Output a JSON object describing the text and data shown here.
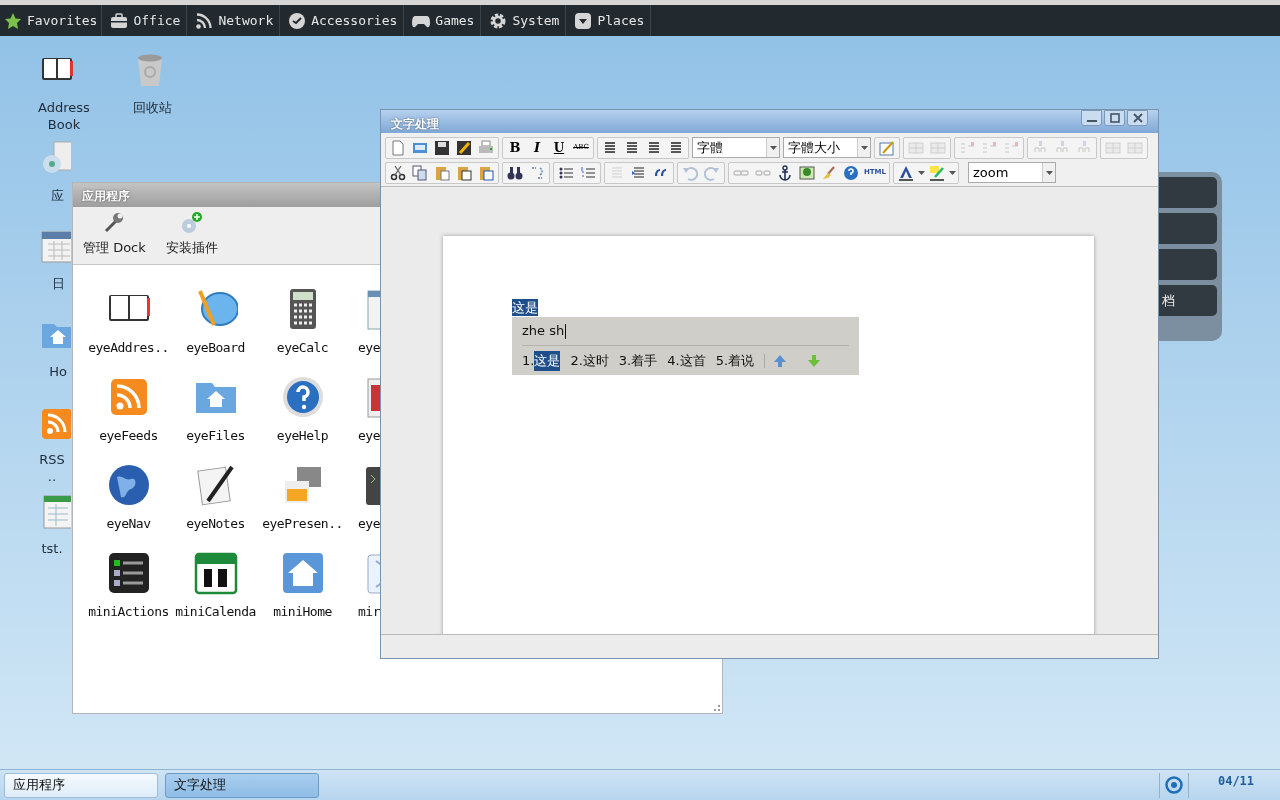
{
  "top_menu": [
    {
      "label": "Favorites"
    },
    {
      "label": "Office"
    },
    {
      "label": "Network"
    },
    {
      "label": "Accessories"
    },
    {
      "label": "Games"
    },
    {
      "label": "System"
    },
    {
      "label": "Places"
    }
  ],
  "desktop_icons": [
    {
      "label": "Address Book"
    },
    {
      "label": "回收站"
    },
    {
      "label": "应"
    },
    {
      "label": "日"
    },
    {
      "label": "Ho"
    },
    {
      "label": "RSS\n.."
    },
    {
      "label": "tst."
    }
  ],
  "dock": {
    "last_label": "档"
  },
  "apps_window": {
    "title": "应用程序",
    "toolbar": [
      {
        "label": "管理 Dock"
      },
      {
        "label": "安装插件"
      }
    ],
    "apps": [
      {
        "label": "eyeAddres.."
      },
      {
        "label": "eyeBoard"
      },
      {
        "label": "eyeCalc"
      },
      {
        "label": "eye"
      },
      {
        "label": "eyeFeeds"
      },
      {
        "label": "eyeFiles"
      },
      {
        "label": "eyeHelp"
      },
      {
        "label": "eye"
      },
      {
        "label": "eyeNav"
      },
      {
        "label": "eyeNotes"
      },
      {
        "label": "eyePresen.."
      },
      {
        "label": "eye"
      },
      {
        "label": "miniActions"
      },
      {
        "label": "miniCalenda"
      },
      {
        "label": "miniHome"
      },
      {
        "label": "mir"
      }
    ]
  },
  "editor_window": {
    "title": "文字处理",
    "format_buttons": [
      "B",
      "I",
      "U",
      "ABC"
    ],
    "font_select": "字體",
    "size_select": "字體大小",
    "html_button": "HTML",
    "zoom_select": "zoom",
    "document": {
      "selected_text": "这是"
    },
    "ime": {
      "input": "zhe sh",
      "candidates": [
        {
          "number": "1.",
          "text": "这是",
          "selected": true
        },
        {
          "number": "2.",
          "text": "这时",
          "selected": false
        },
        {
          "number": "3.",
          "text": "着手",
          "selected": false
        },
        {
          "number": "4.",
          "text": "这首",
          "selected": false
        },
        {
          "number": "5.",
          "text": "着说",
          "selected": false
        }
      ]
    }
  },
  "taskbar": {
    "tasks": [
      {
        "label": "应用程序",
        "selected": false
      },
      {
        "label": "文字处理",
        "selected": true
      }
    ],
    "date": "04/11"
  }
}
